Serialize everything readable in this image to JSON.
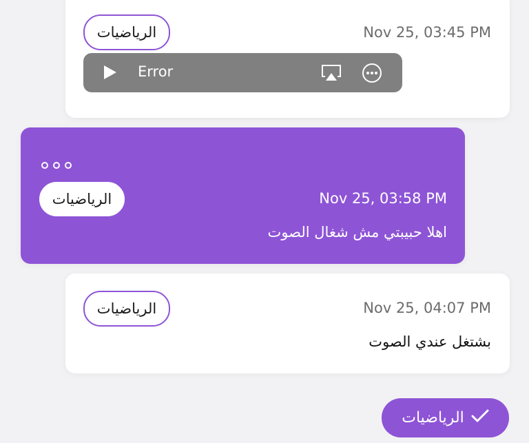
{
  "messages": [
    {
      "timestamp": "Nov 25, 03:45 PM",
      "tag": "الرياضيات",
      "audio": {
        "status_label": "Error"
      }
    },
    {
      "timestamp": "Nov 25, 03:58 PM",
      "tag": "الرياضيات",
      "text": "اهلا حبيبتي مش شغال الصوت"
    },
    {
      "timestamp": "Nov 25, 04:07 PM",
      "tag": "الرياضيات",
      "text": "بشتغل عندي الصوت"
    }
  ],
  "status_chip": {
    "label": "الرياضيات"
  },
  "colors": {
    "accent": "#8e54d6",
    "card": "#ffffff",
    "background": "#f2f2f4",
    "audio_player": "#808080",
    "timestamp": "#6b6b6b"
  },
  "icons": [
    "play-icon",
    "airplay-icon",
    "more-options-icon",
    "ellipsis-icon",
    "checkmark-icon"
  ]
}
